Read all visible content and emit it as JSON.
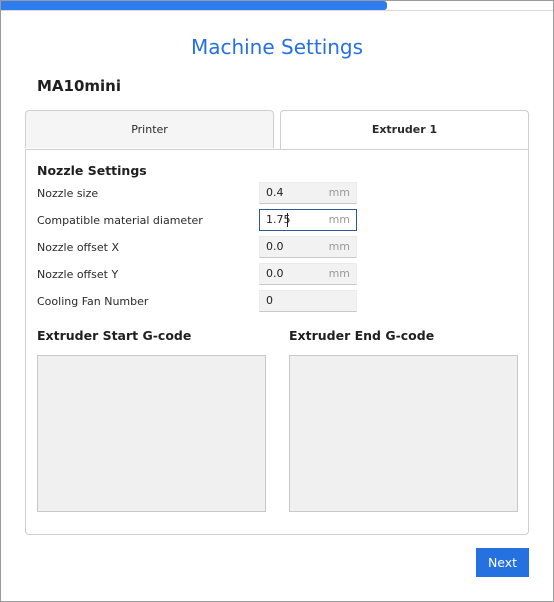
{
  "progress": {
    "fraction": 0.7
  },
  "title": "Machine Settings",
  "machine_name": "MA10mini",
  "tabs": [
    {
      "label": "Printer",
      "selected": false
    },
    {
      "label": "Extruder 1",
      "selected": true
    }
  ],
  "nozzle_settings": {
    "heading": "Nozzle Settings",
    "rows": [
      {
        "label": "Nozzle size",
        "value": "0.4",
        "unit": "mm"
      },
      {
        "label": "Compatible material diameter",
        "value": "1.75",
        "unit": "mm"
      },
      {
        "label": "Nozzle offset X",
        "value": "0.0",
        "unit": "mm"
      },
      {
        "label": "Nozzle offset Y",
        "value": "0.0",
        "unit": "mm"
      },
      {
        "label": "Cooling Fan Number",
        "value": "0",
        "unit": ""
      }
    ]
  },
  "gcode": {
    "start_heading": "Extruder Start G-code",
    "start_value": "",
    "end_heading": "Extruder End G-code",
    "end_value": ""
  },
  "footer": {
    "next_label": "Next"
  },
  "colors": {
    "accent": "#2671e0",
    "progress": "#2f7cf0",
    "field_background": "#f2f2f2"
  }
}
